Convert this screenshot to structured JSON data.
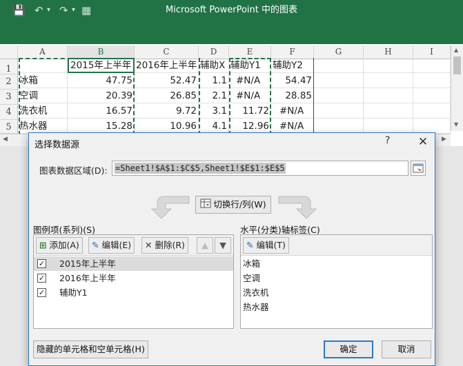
{
  "window": {
    "title": "Microsoft PowerPoint 中的图表",
    "quick_access": {
      "save": "💾",
      "undo": "↶",
      "undo_caret": "▾",
      "redo": "↷",
      "redo_caret": "▾",
      "sheet": "▦"
    },
    "accent": "#217346"
  },
  "sheet": {
    "columns": [
      "A",
      "B",
      "C",
      "D",
      "E",
      "F",
      "G",
      "H",
      "I"
    ],
    "rows": [
      "1",
      "2",
      "3",
      "4",
      "5"
    ],
    "header_row": [
      "",
      "2015年上半年",
      "2016年上半年",
      "辅助X",
      "辅助Y1",
      "辅助Y2"
    ],
    "data_rows": [
      [
        "冰箱",
        "47.75",
        "52.47",
        "1.1",
        "#N/A",
        "54.47"
      ],
      [
        "空调",
        "20.39",
        "26.85",
        "2.1",
        "#N/A",
        "28.85"
      ],
      [
        "洗衣机",
        "16.57",
        "9.72",
        "3.1",
        "11.72",
        "#N/A"
      ],
      [
        "热水器",
        "15.28",
        "10.96",
        "4.1",
        "12.96",
        "#N/A"
      ]
    ]
  },
  "dialog": {
    "title": "选择数据源",
    "help": "?",
    "close": "✕",
    "range_label": "图表数据区域(D):",
    "range_value": "=Sheet1!$A$1:$C$5,Sheet1!$E$1:$E$5",
    "switch_button": "切换行/列(W)",
    "legend_label": "图例项(系列)(S)",
    "add_button": "添加(A)",
    "edit_button": "编辑(E)",
    "remove_button": "删除(R)",
    "series": [
      {
        "name": "2015年上半年",
        "checked": "✓"
      },
      {
        "name": "2016年上半年",
        "checked": "✓"
      },
      {
        "name": "辅助Y1",
        "checked": "✓"
      }
    ],
    "axis_label": "水平(分类)轴标签(C)",
    "axis_edit_button": "编辑(T)",
    "categories": [
      "冰箱",
      "空调",
      "洗衣机",
      "热水器"
    ],
    "hidden_cells_button": "隐藏的单元格和空单元格(H)",
    "ok_button": "确定",
    "cancel_button": "取消"
  }
}
